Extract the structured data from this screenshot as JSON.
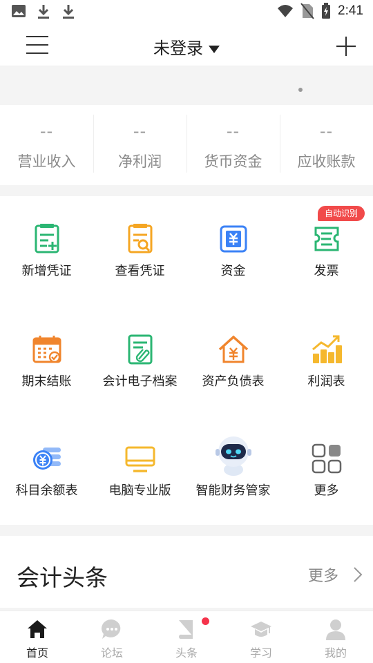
{
  "status_bar": {
    "time": "2:41"
  },
  "header": {
    "title": "未登录"
  },
  "stats": [
    {
      "value": "--",
      "label": "营业收入"
    },
    {
      "value": "--",
      "label": "净利润"
    },
    {
      "value": "--",
      "label": "货币资金"
    },
    {
      "value": "--",
      "label": "应收账款"
    }
  ],
  "grid": {
    "badge": "自动识别",
    "items": [
      {
        "label": "新增凭证",
        "icon": "add-voucher-icon"
      },
      {
        "label": "查看凭证",
        "icon": "view-voucher-icon"
      },
      {
        "label": "资金",
        "icon": "funds-icon"
      },
      {
        "label": "发票",
        "icon": "invoice-icon"
      },
      {
        "label": "期末结账",
        "icon": "period-close-icon"
      },
      {
        "label": "会计电子档案",
        "icon": "e-archive-icon"
      },
      {
        "label": "资产负债表",
        "icon": "balance-sheet-icon"
      },
      {
        "label": "利润表",
        "icon": "profit-chart-icon"
      },
      {
        "label": "科目余额表",
        "icon": "account-balance-icon"
      },
      {
        "label": "电脑专业版",
        "icon": "desktop-icon"
      },
      {
        "label": "智能财务管家",
        "icon": "robot-icon"
      },
      {
        "label": "更多",
        "icon": "more-grid-icon"
      }
    ]
  },
  "news": {
    "title": "会计头条",
    "more": "更多"
  },
  "tabs": [
    {
      "label": "首页",
      "icon": "home-icon"
    },
    {
      "label": "论坛",
      "icon": "forum-icon"
    },
    {
      "label": "头条",
      "icon": "headlines-icon"
    },
    {
      "label": "学习",
      "icon": "study-icon"
    },
    {
      "label": "我的",
      "icon": "profile-icon"
    }
  ],
  "colors": {
    "green": "#2bb673",
    "orange": "#f5a623",
    "blue": "#3b82f6",
    "red": "#f14a4a"
  }
}
